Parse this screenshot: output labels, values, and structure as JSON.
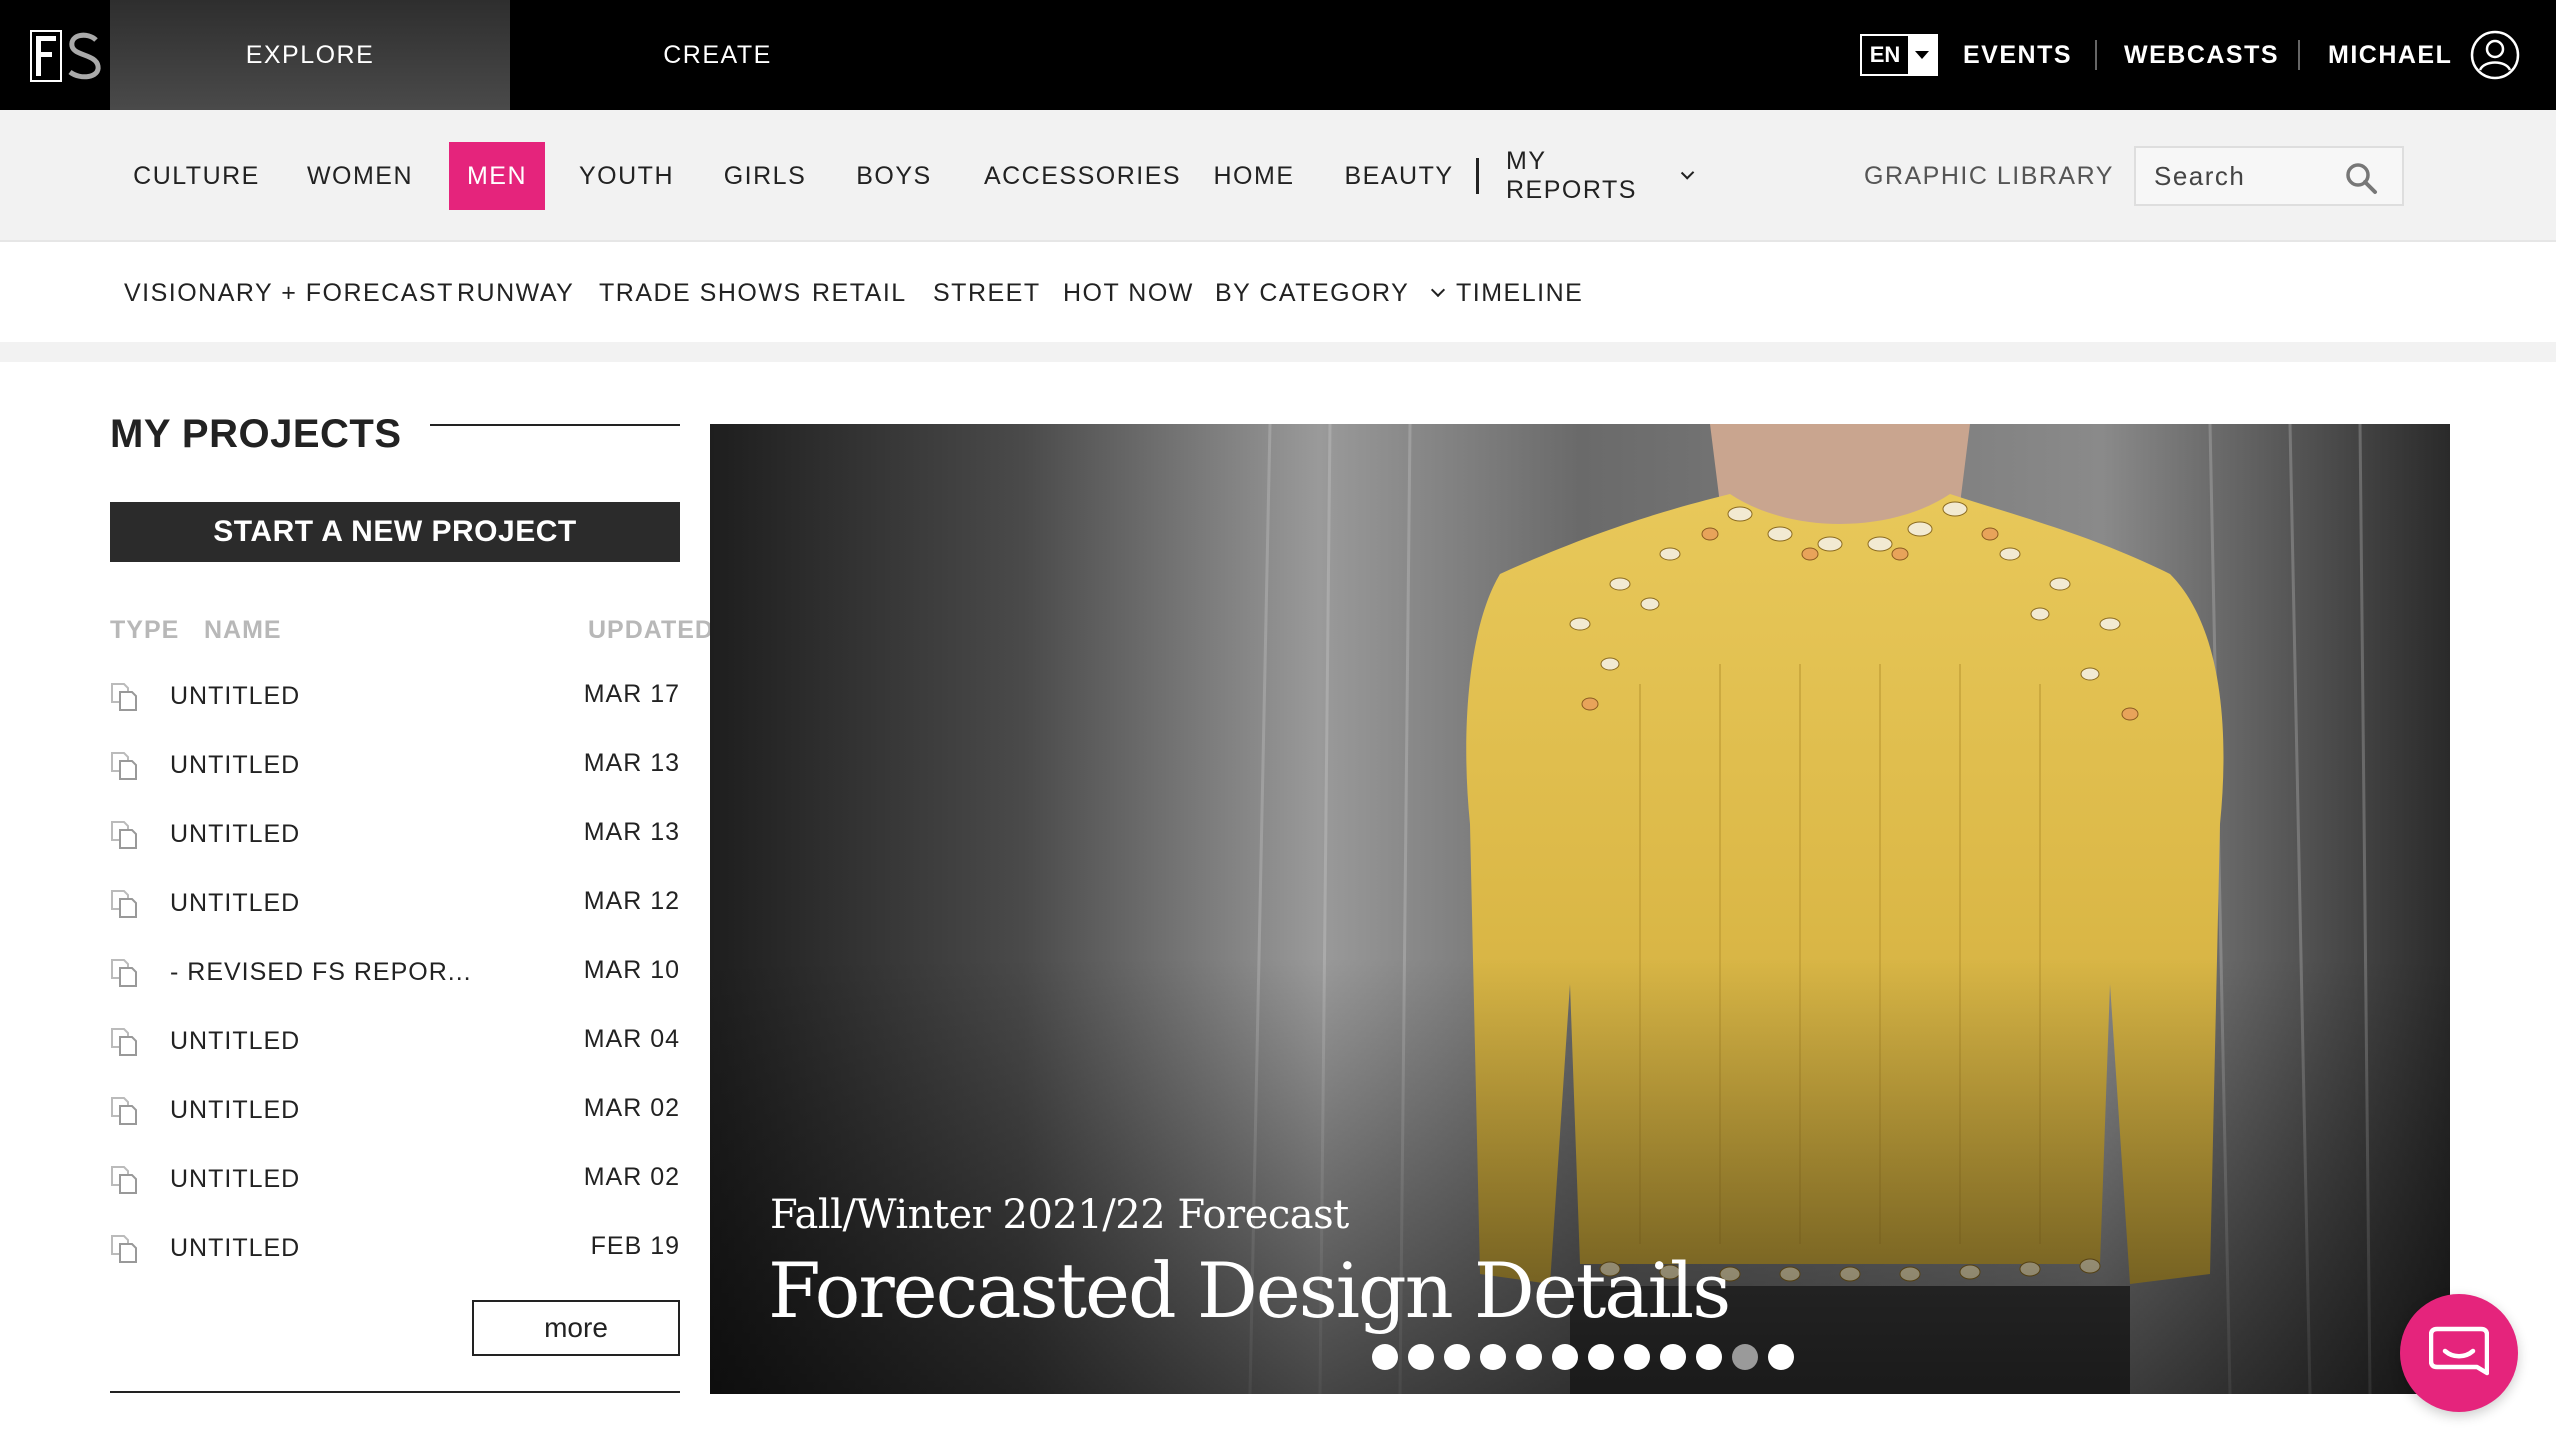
{
  "topbar": {
    "logo_text": "FS",
    "explore_label": "EXPLORE",
    "create_label": "CREATE",
    "language": "EN",
    "events_label": "EVENTS",
    "webcasts_label": "WEBCASTS",
    "user_label": "MICHAEL"
  },
  "categories": {
    "items": [
      {
        "label": "CULTURE"
      },
      {
        "label": "WOMEN"
      },
      {
        "label": "MEN"
      },
      {
        "label": "YOUTH"
      },
      {
        "label": "GIRLS"
      },
      {
        "label": "BOYS"
      },
      {
        "label": "ACCESSORIES"
      },
      {
        "label": "HOME"
      },
      {
        "label": "BEAUTY"
      }
    ],
    "active": "MEN",
    "my_reports_label": "MY REPORTS",
    "graphic_library_label": "GRAPHIC LIBRARY",
    "search_placeholder": "Search",
    "accent_color": "#e5247c"
  },
  "subnav": {
    "items": [
      {
        "label": "VISIONARY + FORECAST"
      },
      {
        "label": "RUNWAY"
      },
      {
        "label": "TRADE SHOWS"
      },
      {
        "label": "RETAIL"
      },
      {
        "label": "STREET"
      },
      {
        "label": "HOT NOW"
      },
      {
        "label": "BY CATEGORY"
      },
      {
        "label": "TIMELINE"
      }
    ]
  },
  "projects": {
    "title": "MY PROJECTS",
    "new_button": "START A NEW PROJECT",
    "columns": {
      "type": "TYPE",
      "name": "NAME",
      "updated": "UPDATED"
    },
    "rows": [
      {
        "name": "UNTITLED",
        "updated": "MAR 17"
      },
      {
        "name": "UNTITLED",
        "updated": "MAR 13"
      },
      {
        "name": "UNTITLED",
        "updated": "MAR 13"
      },
      {
        "name": "UNTITLED",
        "updated": "MAR 12"
      },
      {
        "name": "- REVISED FS REPOR...",
        "updated": "MAR 10"
      },
      {
        "name": "UNTITLED",
        "updated": "MAR 04"
      },
      {
        "name": "UNTITLED",
        "updated": "MAR 02"
      },
      {
        "name": "UNTITLED",
        "updated": "MAR 02"
      },
      {
        "name": "UNTITLED",
        "updated": "FEB 19"
      }
    ],
    "more_label": "more"
  },
  "hero": {
    "subtitle": "Fall/Winter 2021/22 Forecast",
    "title": "Forecasted Design Details",
    "slide_count": 12,
    "inactive_slide": 11
  }
}
